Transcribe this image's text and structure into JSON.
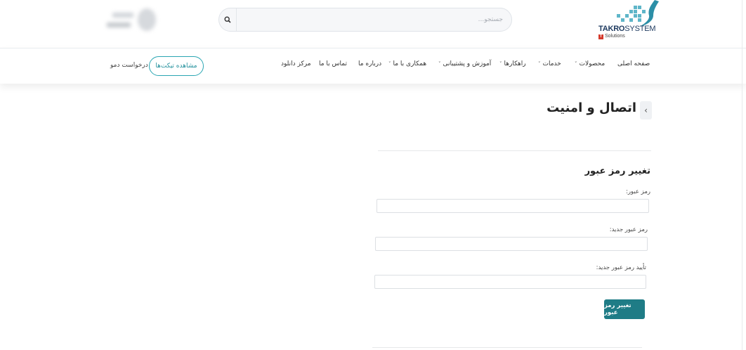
{
  "header": {
    "logo": {
      "brand_bold": "TAKRO",
      "brand_light": "SYSTEM",
      "sub": "Solutions",
      "badge": "T"
    },
    "search": {
      "placeholder": "جستجو...",
      "icon": "search-icon"
    }
  },
  "nav": {
    "items": [
      {
        "label": "صفحه اصلی",
        "has_dropdown": false
      },
      {
        "label": "محصولات",
        "has_dropdown": true
      },
      {
        "label": "خدمات",
        "has_dropdown": true
      },
      {
        "label": "راهکارها",
        "has_dropdown": true
      },
      {
        "label": "آموزش و پشتیبانی",
        "has_dropdown": true
      },
      {
        "label": "همکاری با ما",
        "has_dropdown": true
      },
      {
        "label": "درباره ما",
        "has_dropdown": false
      },
      {
        "label": "تماس با ما",
        "has_dropdown": false
      },
      {
        "label": "مرکز دانلود",
        "has_dropdown": false
      }
    ],
    "tickets_button": "مشاهده تیکت‌ها",
    "demo_link": "درخواست دمو",
    "chevron": "˅"
  },
  "main": {
    "back_icon": "‹",
    "page_title": "اتصال و امنیت",
    "form": {
      "title": "تغییر رمز عبور",
      "fields": [
        {
          "label": "رمز عبور:",
          "value": ""
        },
        {
          "label": "رمز عبور جدید:",
          "value": ""
        },
        {
          "label": "تأیید رمز عبور جدید:",
          "value": ""
        }
      ],
      "submit_label": "تغییر رمز عبور"
    }
  },
  "colors": {
    "accent": "#1f7c86",
    "accent_outline": "#2aa6b3",
    "logo_dots": "#5fb6c9",
    "logo_badge": "#d43a2c"
  }
}
